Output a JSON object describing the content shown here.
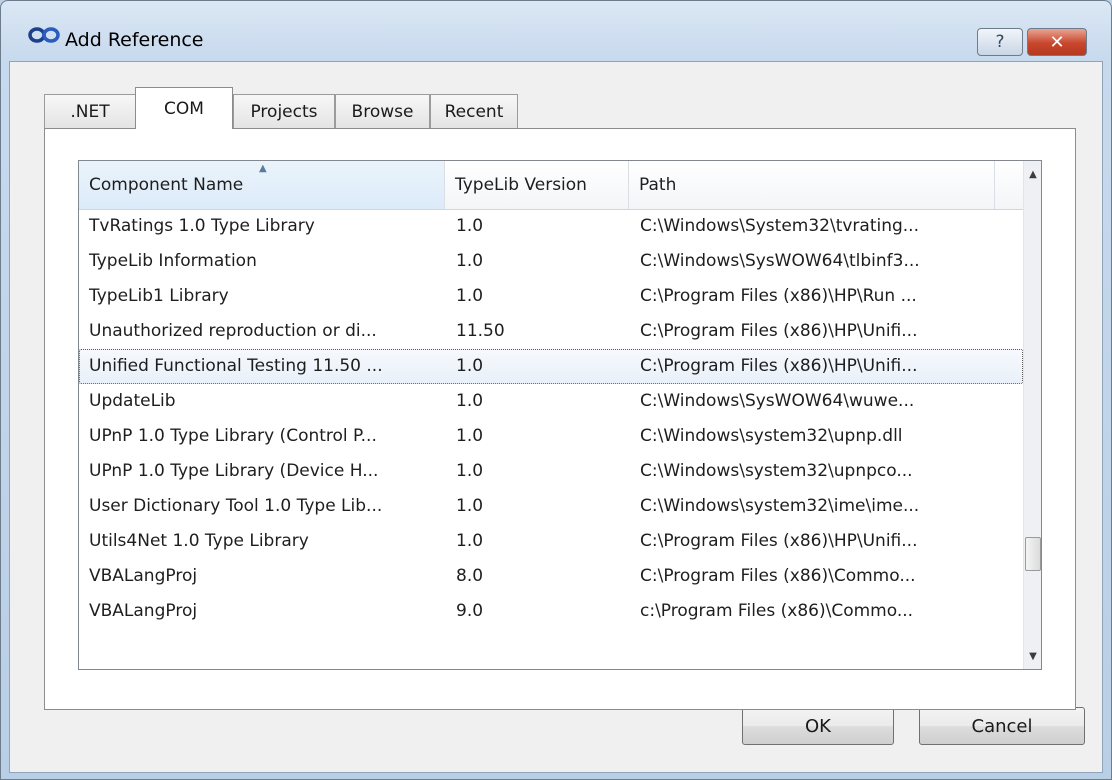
{
  "window": {
    "title": "Add Reference",
    "help_glyph": "?",
    "close_glyph": "✕"
  },
  "tabs": [
    {
      "label": ".NET"
    },
    {
      "label": "COM"
    },
    {
      "label": "Projects"
    },
    {
      "label": "Browse"
    },
    {
      "label": "Recent"
    }
  ],
  "active_tab": "COM",
  "list": {
    "columns": [
      "Component Name",
      "TypeLib Version",
      "Path"
    ],
    "sort_glyph": "▲",
    "rows": [
      {
        "name": "TvRatings 1.0 Type Library",
        "version": "1.0",
        "path": "C:\\Windows\\System32\\tvrating..."
      },
      {
        "name": "TypeLib Information",
        "version": "1.0",
        "path": "C:\\Windows\\SysWOW64\\tlbinf3..."
      },
      {
        "name": "TypeLib1 Library",
        "version": "1.0",
        "path": "C:\\Program Files (x86)\\HP\\Run ..."
      },
      {
        "name": "Unauthorized reproduction or di...",
        "version": "11.50",
        "path": "C:\\Program Files (x86)\\HP\\Unifi..."
      },
      {
        "name": "Unified Functional Testing 11.50 ...",
        "version": "1.0",
        "path": "C:\\Program Files (x86)\\HP\\Unifi..."
      },
      {
        "name": "UpdateLib",
        "version": "1.0",
        "path": "C:\\Windows\\SysWOW64\\wuwe..."
      },
      {
        "name": "UPnP 1.0 Type Library (Control P...",
        "version": "1.0",
        "path": "C:\\Windows\\system32\\upnp.dll"
      },
      {
        "name": "UPnP 1.0 Type Library (Device H...",
        "version": "1.0",
        "path": "C:\\Windows\\system32\\upnpco..."
      },
      {
        "name": "User Dictionary Tool 1.0 Type Lib...",
        "version": "1.0",
        "path": "C:\\Windows\\system32\\ime\\ime..."
      },
      {
        "name": "Utils4Net 1.0 Type Library",
        "version": "1.0",
        "path": "C:\\Program Files (x86)\\HP\\Unifi..."
      },
      {
        "name": "VBALangProj",
        "version": "8.0",
        "path": "C:\\Program Files (x86)\\Commo..."
      },
      {
        "name": "VBALangProj",
        "version": "9.0",
        "path": "c:\\Program Files (x86)\\Commo..."
      }
    ],
    "selected_index": 4,
    "scroll_up_glyph": "▲",
    "scroll_down_glyph": "▼"
  },
  "buttons": {
    "ok": "OK",
    "cancel": "Cancel"
  },
  "icons": {
    "app": "infinity-link-icon",
    "help": "help-icon",
    "close": "close-icon"
  },
  "colors": {
    "frame": "#c7d9ed",
    "close_button": "#c9462c",
    "selection": "#e9f0f9"
  }
}
